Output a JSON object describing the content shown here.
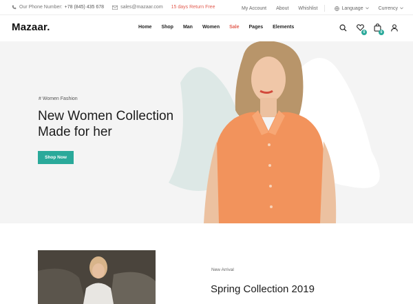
{
  "topbar": {
    "phone_label": "Our Phone Number:",
    "phone_number": "+78 (845) 435 678",
    "email": "sales@mazaar.com",
    "promo": "15 days Return Free",
    "links": {
      "account": "My Account",
      "about": "About",
      "wishlist": "Whishlist",
      "language": "Language",
      "currency": "Currency"
    }
  },
  "header": {
    "logo": "Mazaar.",
    "nav": [
      "Home",
      "Shop",
      "Man",
      "Women",
      "Sale",
      "Pages",
      "Elements"
    ],
    "wishlist_count": "0",
    "cart_count": "0"
  },
  "hero": {
    "tag": "# Women Fashion",
    "title_line1": "New Women Collection",
    "title_line2": "Made for her",
    "button": "Shop Now"
  },
  "arrival": {
    "label": "New Arrival",
    "title": "Spring Collection 2019"
  },
  "colors": {
    "accent": "#2aa99a",
    "sale": "#e25c50",
    "hero_bg": "#f4f4f4",
    "blob": "#dde8e6",
    "shirt": "#f2935c"
  }
}
